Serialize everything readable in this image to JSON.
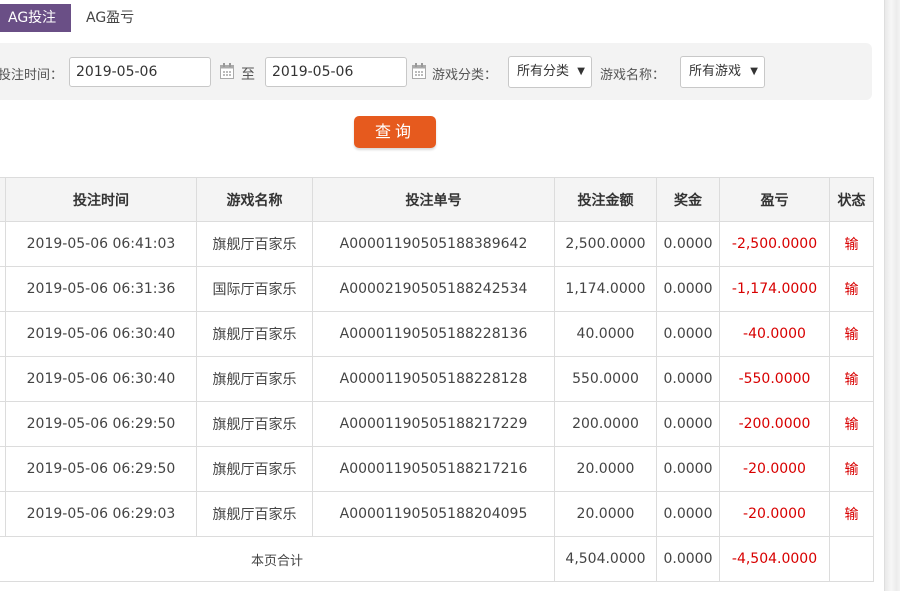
{
  "tabs": [
    {
      "label": "AG投注",
      "active": true
    },
    {
      "label": "AG盈亏",
      "active": false
    }
  ],
  "filter": {
    "time_label": "投注时间：",
    "start_date": "2019-05-06",
    "to_label": "至",
    "end_date": "2019-05-06",
    "category_label": "游戏分类：",
    "category_value": "所有分类",
    "game_label": "游戏名称：",
    "game_value": "所有游戏",
    "query_label": "查询"
  },
  "table": {
    "headers": [
      "投注时间",
      "游戏名称",
      "投注单号",
      "投注金额",
      "奖金",
      "盈亏",
      "状态"
    ],
    "rows": [
      {
        "time": "2019-05-06 06:41:03",
        "game": "旗舰厅百家乐",
        "order": "A0000119050518838 9642",
        "amount": "2,500.0000",
        "bonus": "0.0000",
        "profit": "-2,500.0000",
        "status": "输"
      },
      {
        "time": "2019-05-06 06:31:36",
        "game": "国际厅百家乐",
        "order": "A0000219050518824 2534",
        "amount": "1,174.0000",
        "bonus": "0.0000",
        "profit": "-1,174.0000",
        "status": "输"
      },
      {
        "time": "2019-05-06 06:30:40",
        "game": "旗舰厅百家乐",
        "order": "A0000119050518822 8136",
        "amount": "40.0000",
        "bonus": "0.0000",
        "profit": "-40.0000",
        "status": "输"
      },
      {
        "time": "2019-05-06 06:30:40",
        "game": "旗舰厅百家乐",
        "order": "A0000119050518822 8128",
        "amount": "550.0000",
        "bonus": "0.0000",
        "profit": "-550.0000",
        "status": "输"
      },
      {
        "time": "2019-05-06 06:29:50",
        "game": "旗舰厅百家乐",
        "order": "A0000119050518821 7229",
        "amount": "200.0000",
        "bonus": "0.0000",
        "profit": "-200.0000",
        "status": "输"
      },
      {
        "time": "2019-05-06 06:29:50",
        "game": "旗舰厅百家乐",
        "order": "A0000119050518821 7216",
        "amount": "20.0000",
        "bonus": "0.0000",
        "profit": "-20.0000",
        "status": "输"
      },
      {
        "time": "2019-05-06 06:29:03",
        "game": "旗舰厅百家乐",
        "order": "A0000119050518820 4095",
        "amount": "20.0000",
        "bonus": "0.0000",
        "profit": "-20.0000",
        "status": "输"
      }
    ],
    "summary": {
      "label": "本页合计",
      "amount": "4,504.0000",
      "bonus": "0.0000",
      "profit": "-4,504.0000"
    }
  }
}
